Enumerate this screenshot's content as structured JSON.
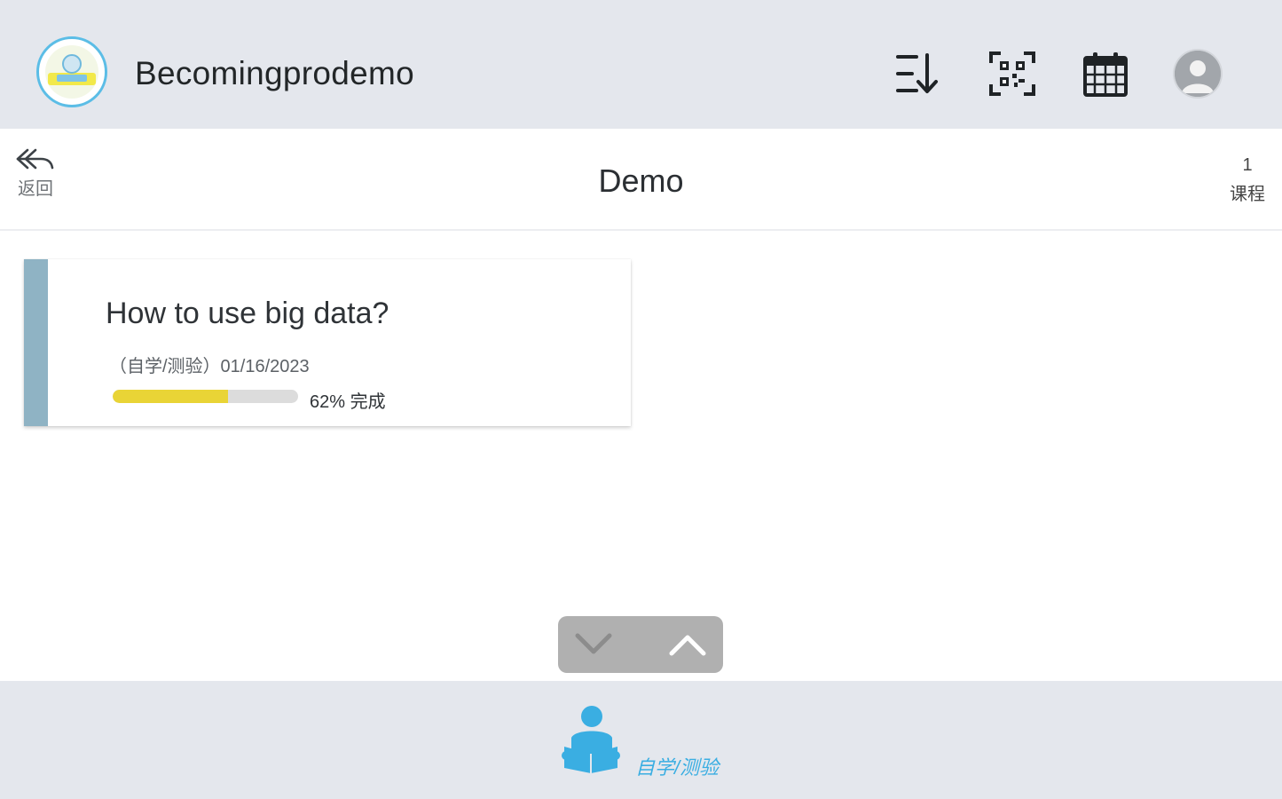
{
  "header": {
    "app_name": "Becomingprodemo",
    "icons": [
      "sort-icon",
      "qr-scan-icon",
      "calendar-icon",
      "user-avatar-icon"
    ]
  },
  "subheader": {
    "back_label": "返回",
    "title": "Demo",
    "course_count": "1",
    "course_count_label": "课程"
  },
  "courses": [
    {
      "title": "How to use big data?",
      "meta": "（自学/测验）01/16/2023",
      "progress_percent": 62,
      "progress_text": "62% 完成"
    }
  ],
  "scroll": {
    "down_icon": "chevron-down-icon",
    "up_icon": "chevron-up-icon"
  },
  "tabbar": {
    "active_tab_label": "自学/测验",
    "active_tab_icon": "reading-person-icon"
  },
  "colors": {
    "header_bg": "#e4e7ed",
    "card_accent": "#8fb3c4",
    "progress_fill": "#e9d436",
    "tab_active": "#3aaee2"
  }
}
